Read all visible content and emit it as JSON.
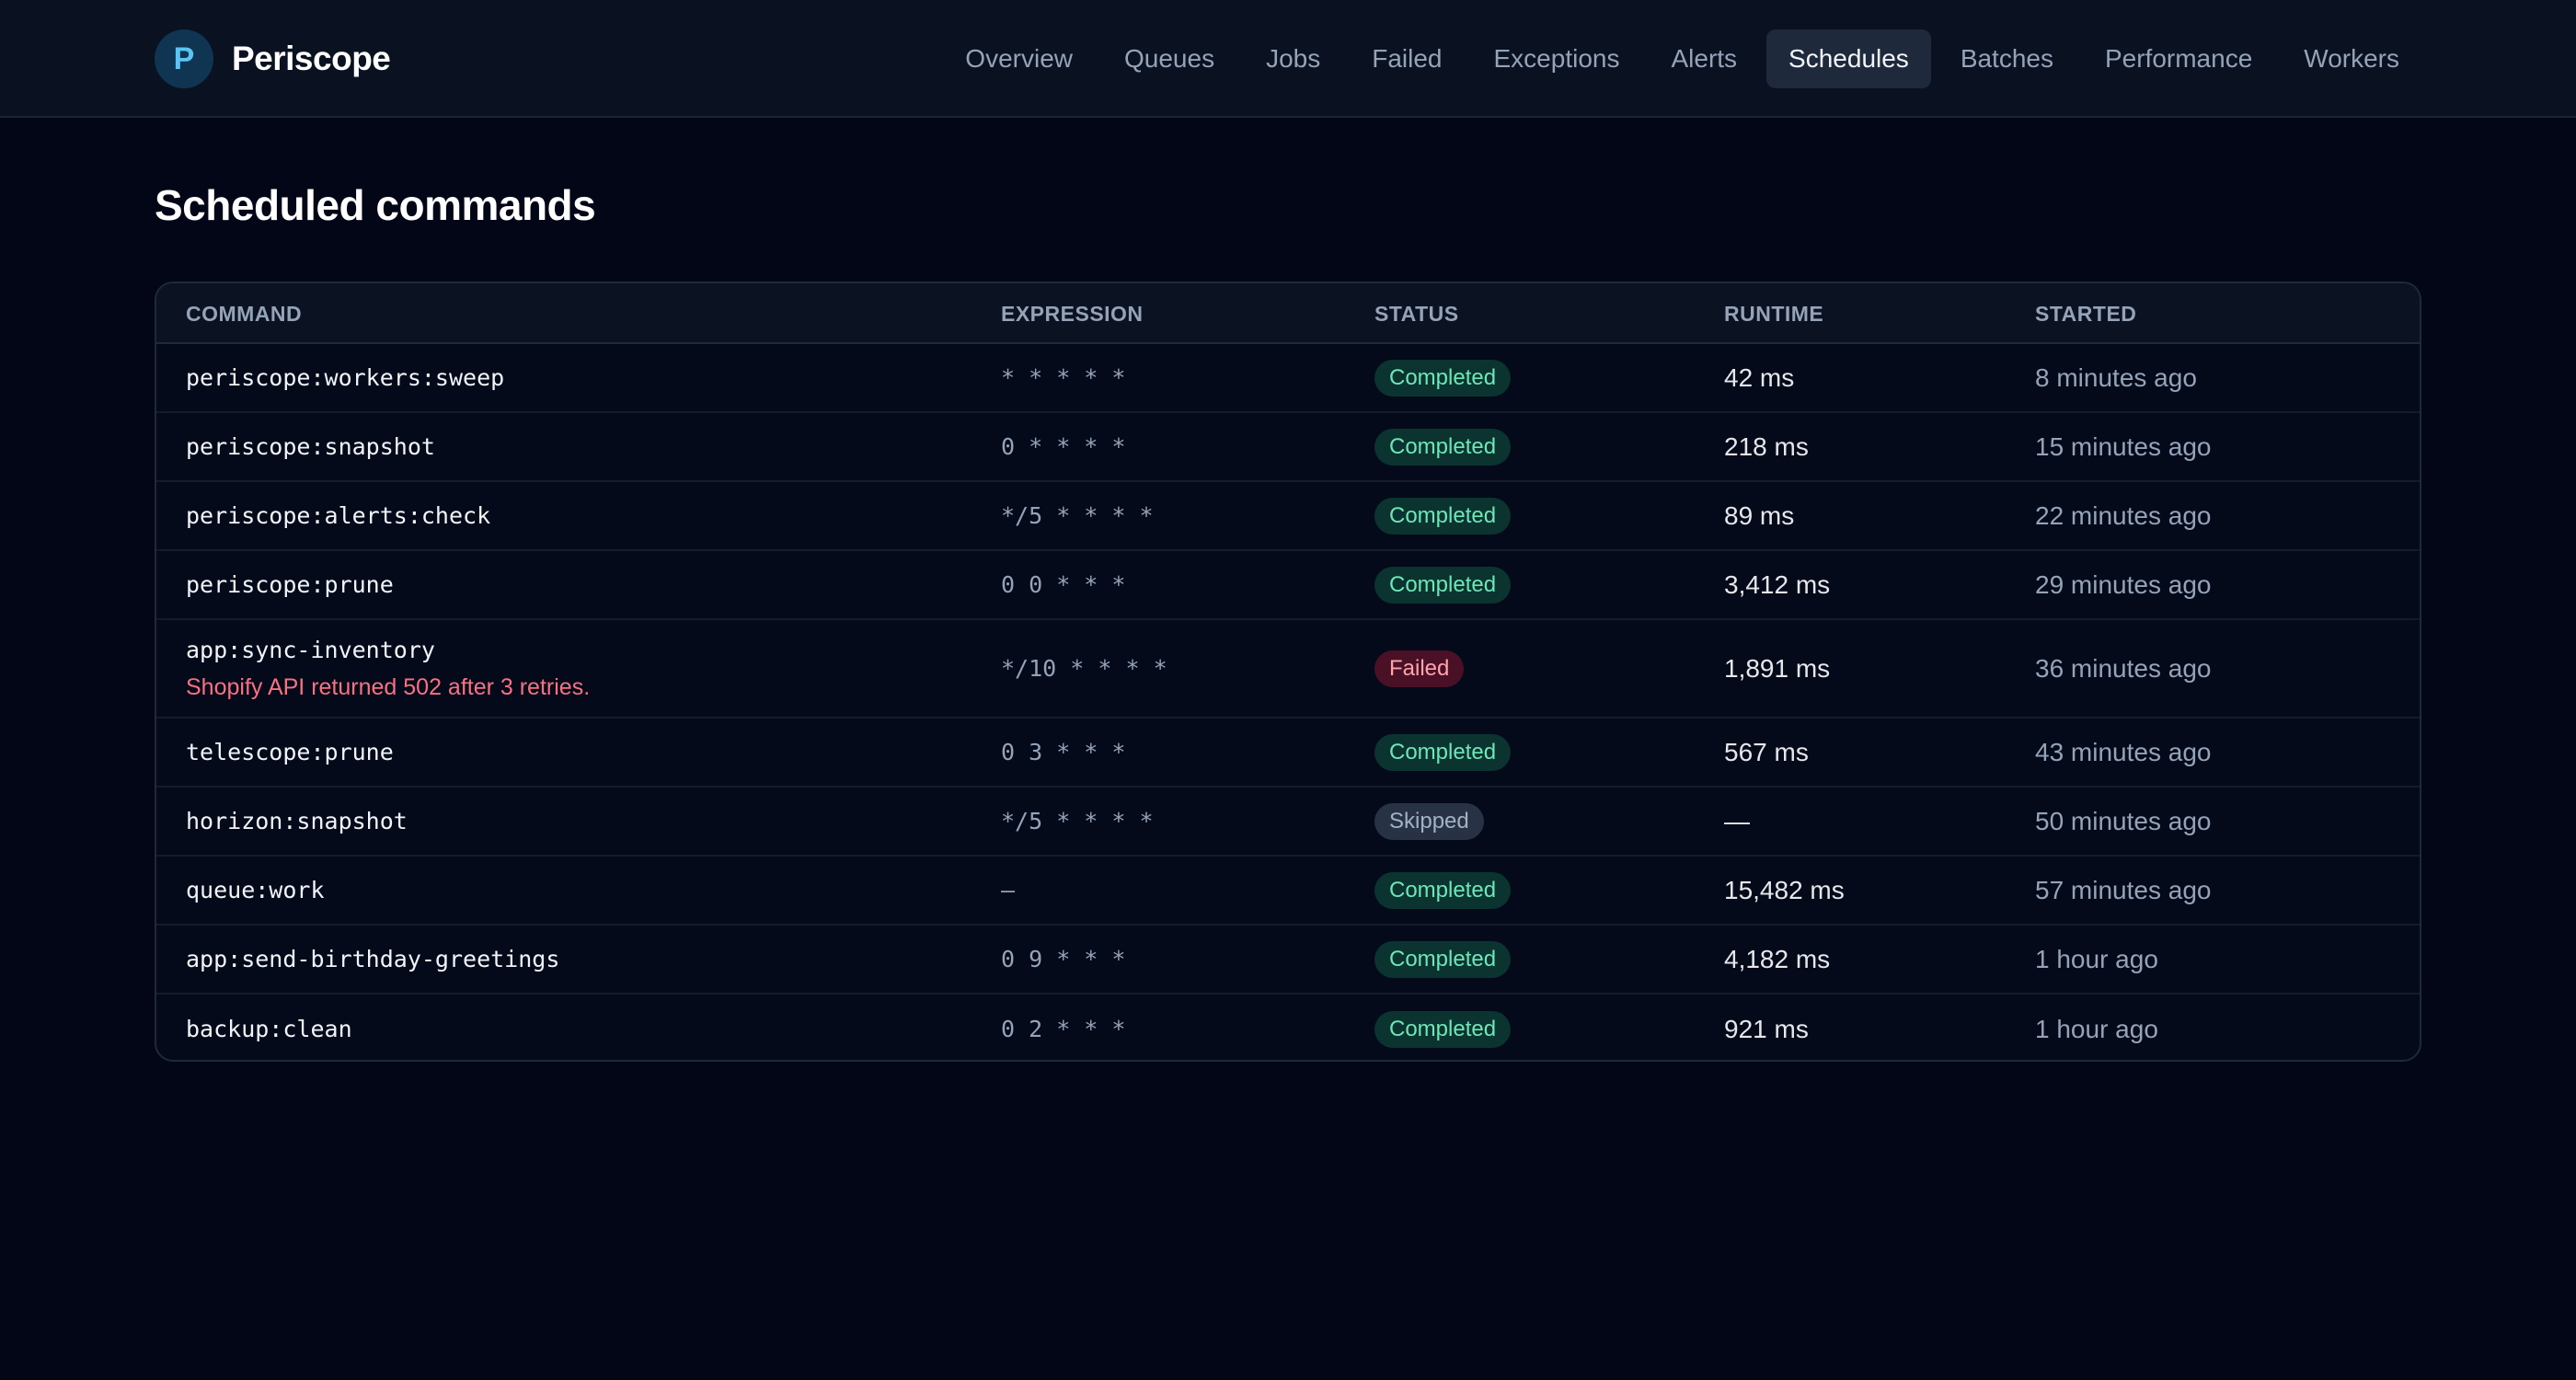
{
  "app": {
    "logo_letter": "P",
    "name": "Periscope"
  },
  "nav": {
    "items": [
      {
        "label": "Overview",
        "active": false
      },
      {
        "label": "Queues",
        "active": false
      },
      {
        "label": "Jobs",
        "active": false
      },
      {
        "label": "Failed",
        "active": false
      },
      {
        "label": "Exceptions",
        "active": false
      },
      {
        "label": "Alerts",
        "active": false
      },
      {
        "label": "Schedules",
        "active": true
      },
      {
        "label": "Batches",
        "active": false
      },
      {
        "label": "Performance",
        "active": false
      },
      {
        "label": "Workers",
        "active": false
      }
    ]
  },
  "page": {
    "title": "Scheduled commands"
  },
  "table": {
    "columns": {
      "command": "COMMAND",
      "expression": "EXPRESSION",
      "status": "STATUS",
      "runtime": "RUNTIME",
      "started": "STARTED"
    },
    "rows": [
      {
        "command": "periscope:workers:sweep",
        "error": "",
        "expression": "* * * * *",
        "status": "Completed",
        "status_kind": "completed",
        "runtime": "42 ms",
        "started": "8 minutes ago"
      },
      {
        "command": "periscope:snapshot",
        "error": "",
        "expression": "0 * * * *",
        "status": "Completed",
        "status_kind": "completed",
        "runtime": "218 ms",
        "started": "15 minutes ago"
      },
      {
        "command": "periscope:alerts:check",
        "error": "",
        "expression": "*/5 * * * *",
        "status": "Completed",
        "status_kind": "completed",
        "runtime": "89 ms",
        "started": "22 minutes ago"
      },
      {
        "command": "periscope:prune",
        "error": "",
        "expression": "0 0 * * *",
        "status": "Completed",
        "status_kind": "completed",
        "runtime": "3,412 ms",
        "started": "29 minutes ago"
      },
      {
        "command": "app:sync-inventory",
        "error": "Shopify API returned 502 after 3 retries.",
        "expression": "*/10 * * * *",
        "status": "Failed",
        "status_kind": "failed",
        "runtime": "1,891 ms",
        "started": "36 minutes ago"
      },
      {
        "command": "telescope:prune",
        "error": "",
        "expression": "0 3 * * *",
        "status": "Completed",
        "status_kind": "completed",
        "runtime": "567 ms",
        "started": "43 minutes ago"
      },
      {
        "command": "horizon:snapshot",
        "error": "",
        "expression": "*/5 * * * *",
        "status": "Skipped",
        "status_kind": "skipped",
        "runtime": "—",
        "started": "50 minutes ago"
      },
      {
        "command": "queue:work",
        "error": "",
        "expression": "—",
        "status": "Completed",
        "status_kind": "completed",
        "runtime": "15,482 ms",
        "started": "57 minutes ago"
      },
      {
        "command": "app:send-birthday-greetings",
        "error": "",
        "expression": "0 9 * * *",
        "status": "Completed",
        "status_kind": "completed",
        "runtime": "4,182 ms",
        "started": "1 hour ago"
      },
      {
        "command": "backup:clean",
        "error": "",
        "expression": "0 2 * * *",
        "status": "Completed",
        "status_kind": "completed",
        "runtime": "921 ms",
        "started": "1 hour ago"
      }
    ]
  },
  "colors": {
    "background": "#030616",
    "topbar": "#0a1120",
    "completed": "#6ee7b7",
    "failed": "#fda4af",
    "error_text": "#f87181"
  }
}
